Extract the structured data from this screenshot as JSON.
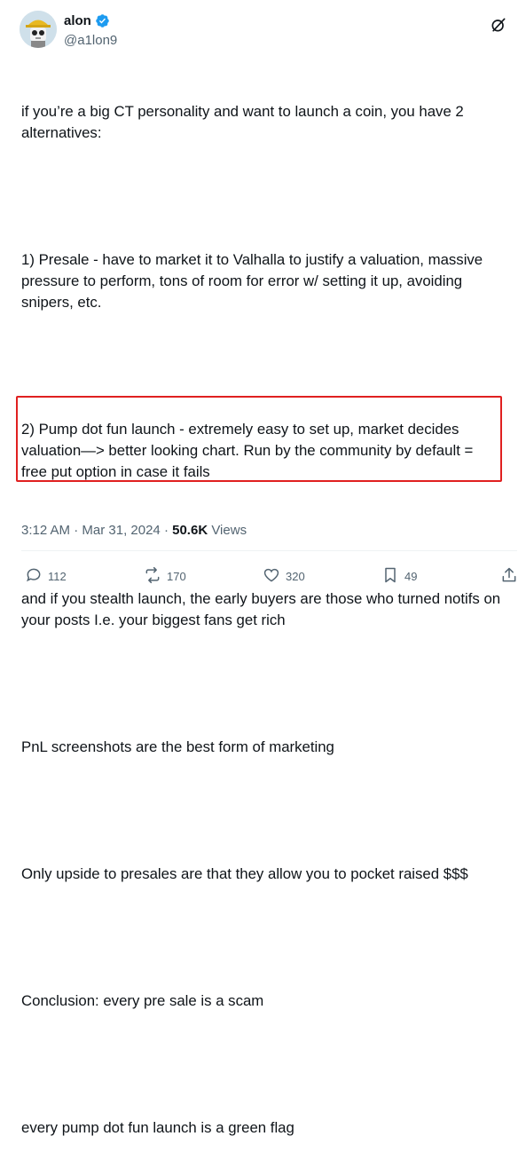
{
  "author": {
    "display_name": "alon",
    "handle": "@a1lon9",
    "verified": true
  },
  "tweet": {
    "paragraphs": [
      "if you’re a big CT personality and want to launch a coin, you have 2\nalternatives:",
      "1) Presale - have to market it to Valhalla to justify a valuation, massive\npressure to perform, tons of room for error w/ setting it up, avoiding\nsnipers, etc.",
      "2) Pump dot fun launch - extremely easy to set up, market decides\nvaluation—> better looking chart. Run by the community by default =\nfree put option in case it fails",
      "and if you stealth launch, the early buyers are those who turned notifs on\nyour posts I.e. your biggest fans get rich",
      "PnL screenshots are the best form of marketing",
      "Only upside to presales are that they allow you to pocket raised $$$",
      "Conclusion: every pre sale is a scam",
      "every pump dot fun launch is a green flag"
    ]
  },
  "meta": {
    "time": "3:12 AM",
    "date": "Mar 31, 2024",
    "separator1": " · ",
    "separator2": " · ",
    "views_count": "50.6K",
    "views_label": " Views"
  },
  "actions": {
    "replies": "112",
    "reposts": "170",
    "likes": "320",
    "bookmarks": "49"
  },
  "colors": {
    "highlight_border": "#e02020",
    "verified": "#1d9bf0",
    "secondary_text": "#536471"
  },
  "icons": [
    "verified-badge-icon",
    "grok-icon",
    "reply-icon",
    "repost-icon",
    "like-icon",
    "bookmark-icon",
    "share-icon"
  ]
}
